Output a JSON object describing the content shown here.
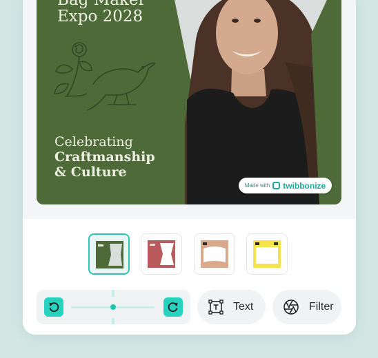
{
  "poster": {
    "event_title_line1": "Bag Maker",
    "event_title_line2": "Expo 2028",
    "tagline_line1": "Celebrating",
    "tagline_line2": "Craftmanship",
    "tagline_line3": "& Culture",
    "badge": {
      "made_with": "Made with",
      "brand": "twibbonize"
    }
  },
  "frames": [
    {
      "name": "green",
      "selected": true
    },
    {
      "name": "red",
      "selected": false
    },
    {
      "name": "tan",
      "selected": false
    },
    {
      "name": "yellow",
      "selected": false
    }
  ],
  "toolbar": {
    "rotate_left_icon": "rotate-ccw-icon",
    "rotate_right_icon": "rotate-cw-icon",
    "rotation_value": 0,
    "text_label": "Text",
    "text_icon": "text-box-icon",
    "filter_label": "Filter",
    "filter_icon": "aperture-icon"
  },
  "colors": {
    "accent": "#27d2bf",
    "poster_green": "#4d6a38",
    "background": "#d3e6e4"
  }
}
